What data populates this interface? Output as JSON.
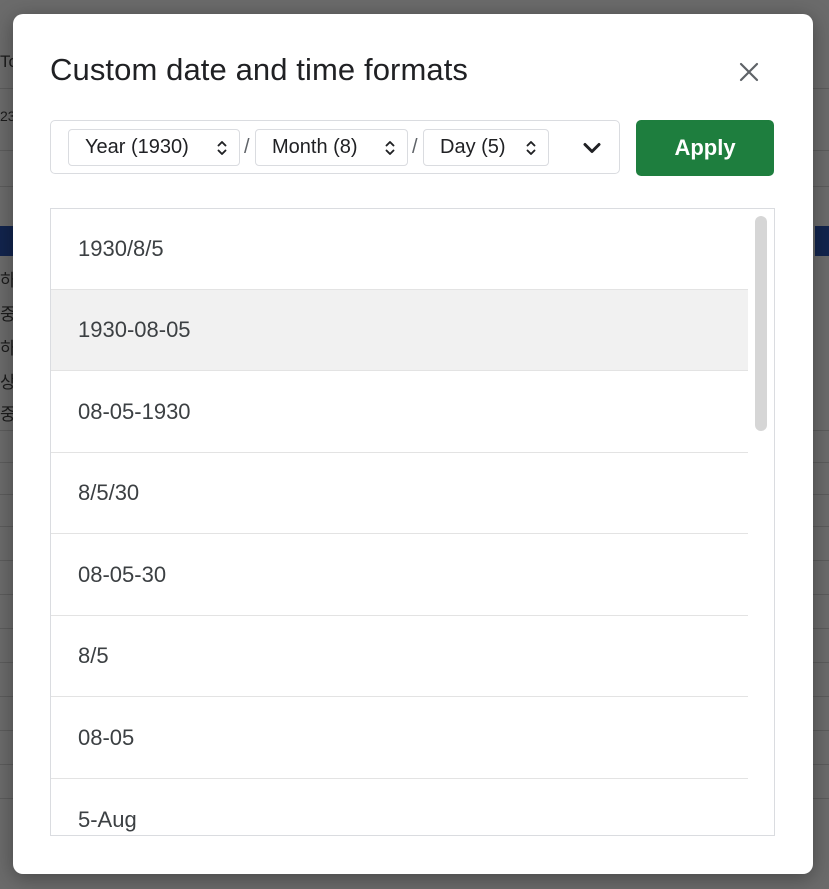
{
  "dialog": {
    "title": "Custom date and time formats",
    "close_icon": "close-icon",
    "apply_label": "Apply"
  },
  "format_bar": {
    "chips": [
      {
        "label": "Year (1930)",
        "icon": "sort-updown-icon"
      },
      {
        "label": "Month (8)",
        "icon": "sort-updown-icon"
      },
      {
        "label": "Day (5)",
        "icon": "sort-updown-icon"
      }
    ],
    "separator": "/",
    "expand_icon": "chevron-down-icon"
  },
  "format_list": {
    "items": [
      "1930/8/5",
      "1930-08-05",
      "08-05-1930",
      "8/5/30",
      "08-05-30",
      "8/5",
      "08-05",
      "5-Aug"
    ],
    "selected_index": 1
  },
  "background": {
    "edge_chars": [
      "To",
      "23",
      "하",
      "중",
      "하",
      "상",
      "중"
    ]
  },
  "colors": {
    "apply_button": "#1e7e3e",
    "selected_row": "#f1f1f1",
    "overlay": "rgba(0,0,0,0.58)"
  }
}
